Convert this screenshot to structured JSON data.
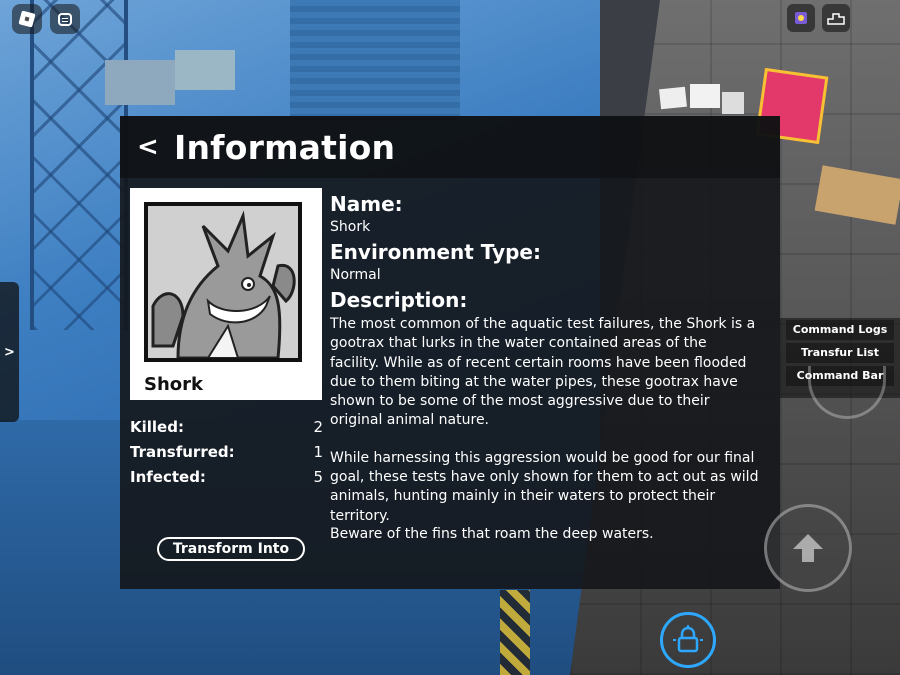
{
  "panel": {
    "back_label": "<",
    "title": "Information"
  },
  "portrait": {
    "name": "Shork"
  },
  "stats": [
    {
      "label": "Killed:",
      "value": "2"
    },
    {
      "label": "Transfurred:",
      "value": "1"
    },
    {
      "label": "Infected:",
      "value": "5"
    }
  ],
  "transform_button": "Transform Into",
  "info": {
    "name_heading": "Name:",
    "name_value": "Shork",
    "env_heading": "Environment Type:",
    "env_value": "Normal",
    "desc_heading": "Description:",
    "desc_p1": "The most common of the aquatic test failures, the Shork is a gootrax that lurks in the water contained areas of the facility. While as of recent certain rooms have been flooded due to them biting at the water pipes, these gootrax have shown to be some of the most aggressive due to their original animal nature.",
    "desc_p2": "While harnessing this aggression would be good for our final goal, these tests have only shown for them to act out as wild animals, hunting mainly in their waters to protect their territory.",
    "footnote": "Beware of the fins that roam the deep waters."
  },
  "right_menu": {
    "items": [
      "Command Logs",
      "Transfur List",
      "Command Bar"
    ]
  },
  "side_tab": ">",
  "icons": {
    "top_left": [
      "roblox-logo-icon",
      "chat-icon"
    ],
    "top_right": [
      "badge-icon",
      "leaderboard-icon"
    ],
    "controls": [
      "jump-arrow-icon",
      "shift-lock-icon"
    ]
  },
  "colors": {
    "panel_bg": "#14161a",
    "accent_lock": "#2ea8ff",
    "text": "#ffffff"
  }
}
